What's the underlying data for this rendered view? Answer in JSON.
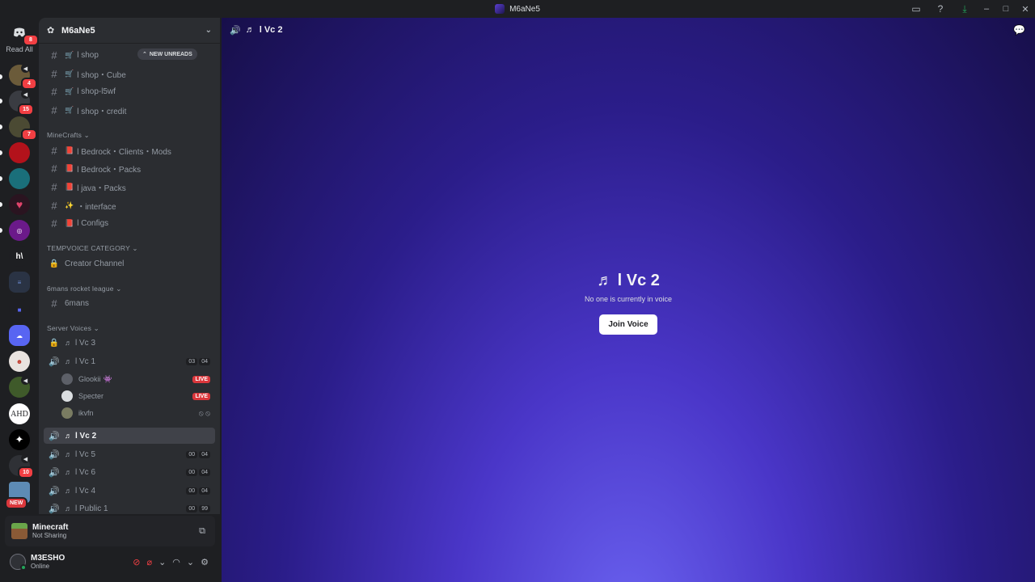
{
  "window": {
    "title": "M6aNe5"
  },
  "rail": {
    "read_all": "Read All",
    "dm_badge": "8",
    "new_label": "NEW",
    "server_ahd": "AHD",
    "server_h": "h\\",
    "badges": [
      "4",
      "15",
      "7",
      "10"
    ]
  },
  "sidebar": {
    "server_name": "M6aNe5",
    "new_unreads": "NEW UNREADS",
    "shop_channels": [
      "l shop",
      "l shop・Cube",
      "l shop-l5wf",
      "l shop・credit"
    ],
    "categories": {
      "minecrafts": "MineCrafts",
      "tempvoice": "TEMPVOICE CATEGORY",
      "rocket": "6mans rocket league",
      "server_voices": "Server Voices"
    },
    "mc_channels": [
      "l Bedrock・Clients・Mods",
      "l Bedrock・Packs",
      "l java・Packs",
      "・interface",
      "l Configs"
    ],
    "creator_channel": "Creator Channel",
    "sixmans": "6mans",
    "voices": [
      {
        "name": "l Vc 3"
      },
      {
        "name": "l Vc 1",
        "a": "03",
        "b": "04"
      },
      {
        "name": "l Vc 2"
      },
      {
        "name": "l Vc 5",
        "a": "00",
        "b": "04"
      },
      {
        "name": "l Vc 6",
        "a": "00",
        "b": "04"
      },
      {
        "name": "l Vc 4",
        "a": "00",
        "b": "04"
      },
      {
        "name": "l Public 1",
        "a": "00",
        "b": "99"
      }
    ],
    "members": [
      {
        "name": "Glookii",
        "status": "LIVE"
      },
      {
        "name": "Specter",
        "status": "LIVE"
      },
      {
        "name": "ikvfn"
      }
    ]
  },
  "activity": {
    "game": "Minecraft",
    "status": "Not Sharing"
  },
  "user": {
    "name": "M3ESHO",
    "status": "Online"
  },
  "main": {
    "header": "l Vc 2",
    "title": "l Vc 2",
    "subtitle": "No one is currently in voice",
    "join": "Join Voice"
  }
}
